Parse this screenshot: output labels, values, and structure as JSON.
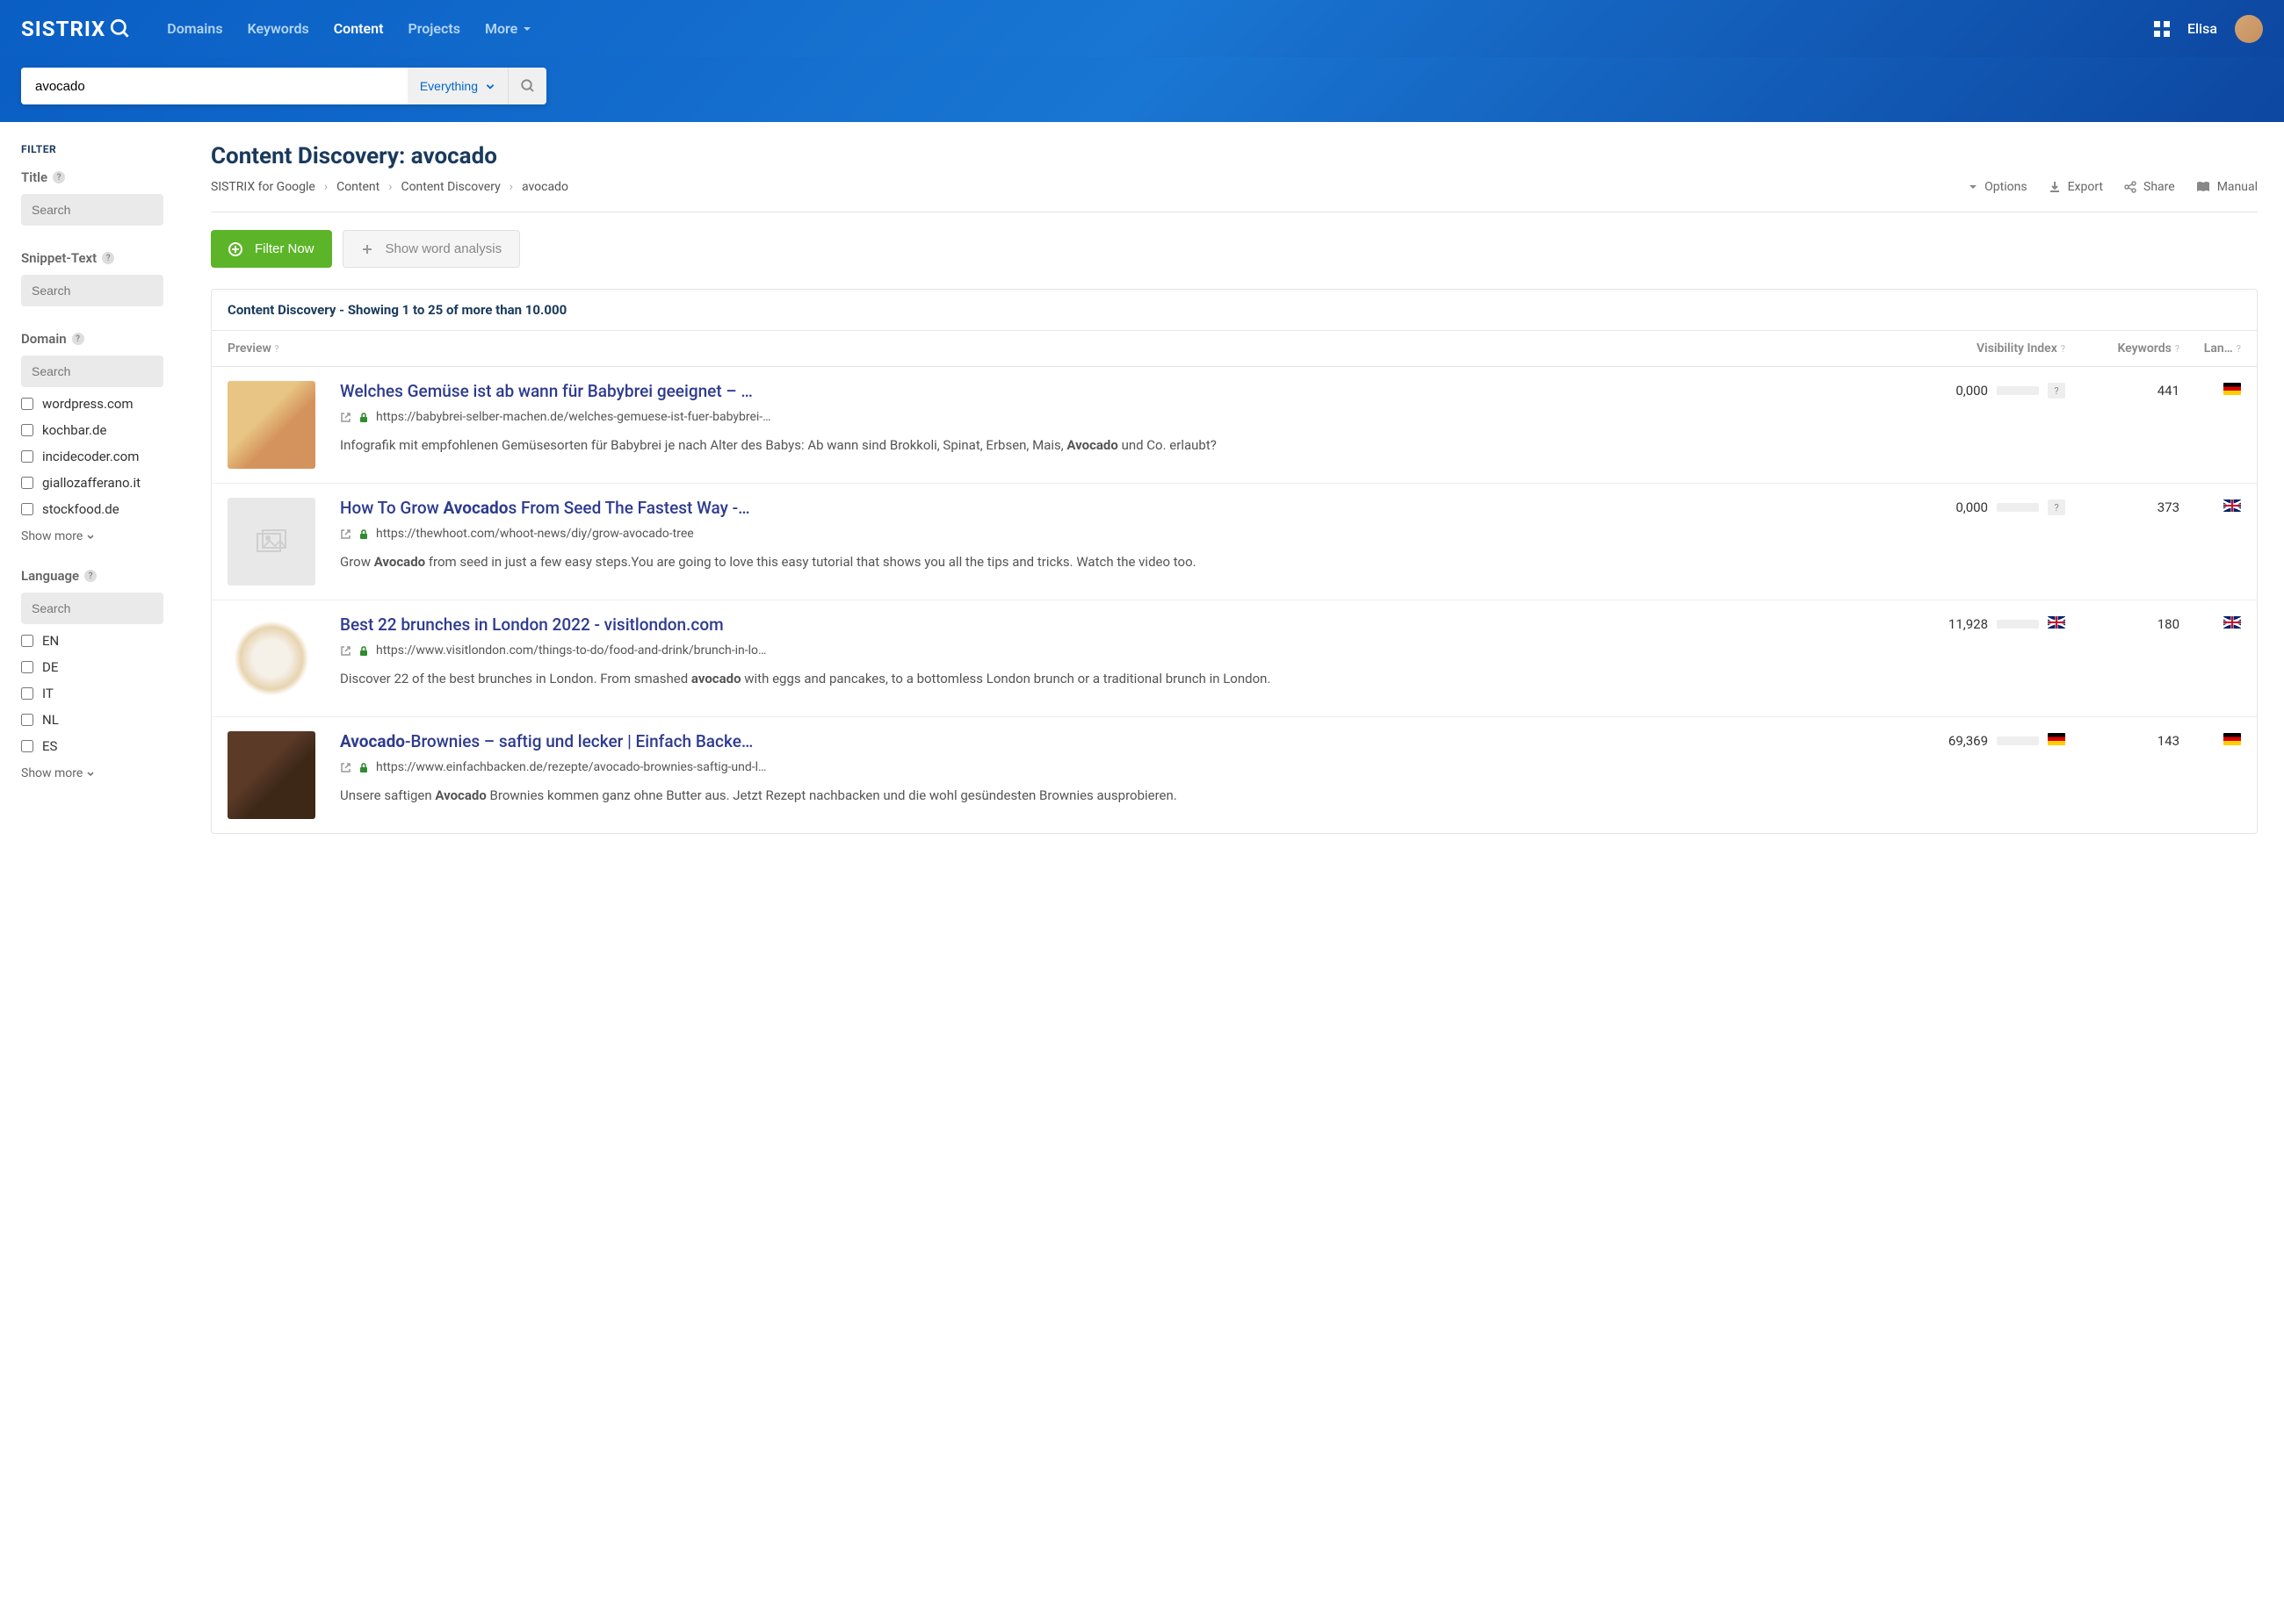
{
  "header": {
    "logo": "SISTRIX",
    "nav": {
      "domains": "Domains",
      "keywords": "Keywords",
      "content": "Content",
      "projects": "Projects",
      "more": "More"
    },
    "user": "Elisa"
  },
  "search": {
    "value": "avocado",
    "filter": "Everything"
  },
  "sidebar": {
    "heading": "FILTER",
    "title": {
      "label": "Title",
      "placeholder": "Search"
    },
    "snippet": {
      "label": "Snippet-Text",
      "placeholder": "Search"
    },
    "domain": {
      "label": "Domain",
      "placeholder": "Search",
      "options": [
        "wordpress.com",
        "kochbar.de",
        "incidecoder.com",
        "giallozafferano.it",
        "stockfood.de"
      ],
      "show_more": "Show more"
    },
    "language": {
      "label": "Language",
      "placeholder": "Search",
      "options": [
        "EN",
        "DE",
        "IT",
        "NL",
        "ES"
      ],
      "show_more": "Show more"
    }
  },
  "main": {
    "title": "Content Discovery: avocado",
    "breadcrumb": [
      "SISTRIX for Google",
      "Content",
      "Content Discovery",
      "avocado"
    ],
    "actions": {
      "options": "Options",
      "export": "Export",
      "share": "Share",
      "manual": "Manual"
    },
    "buttons": {
      "filter_now": "Filter Now",
      "word_analysis": "Show word analysis"
    },
    "results_header": "Content Discovery - Showing 1 to 25 of more than 10.000",
    "columns": {
      "preview": "Preview",
      "vi": "Visibility Index",
      "keywords": "Keywords",
      "lang": "Lan…"
    },
    "results": [
      {
        "title": "Welches Gemüse ist ab wann für Babybrei geeignet – …",
        "url": "https://babybrei-selber-machen.de/welches-gemuese-ist-fuer-babybrei-…",
        "snippet_pre": "Infografik mit empfohlenen Gemüsesorten für Babybrei je nach Alter des Babys: Ab wann sind Brokkoli, Spinat, Erbsen, Mais, ",
        "snippet_bold": "Avocado",
        "snippet_post": " und Co. erlaubt?",
        "vi": "0,000",
        "vi_fill": 0,
        "vi_flag": "?",
        "keywords": "441",
        "lang": "de",
        "thumb": "food1"
      },
      {
        "title_pre": "How To Grow ",
        "title_bold": "Avocado",
        "title_post": "s From Seed The Fastest Way -…",
        "url": "https://thewhoot.com/whoot-news/diy/grow-avocado-tree",
        "snippet_pre": "Grow ",
        "snippet_bold": "Avocado",
        "snippet_post": " from seed in just a few easy steps.You are going to love this easy tutorial that shows you all the tips and tricks. Watch the video too.",
        "vi": "0,000",
        "vi_fill": 0,
        "vi_flag": "?",
        "keywords": "373",
        "lang": "gb",
        "thumb": "placeholder"
      },
      {
        "title": "Best 22 brunches in London 2022 - visitlondon.com",
        "url": "https://www.visitlondon.com/things-to-do/food-and-drink/brunch-in-lo…",
        "snippet_pre": "Discover 22 of the best brunches in London. From smashed ",
        "snippet_bold": "avocado",
        "snippet_post": " with eggs and pancakes, to a bottomless London brunch or a traditional brunch in London.",
        "vi": "11,928",
        "vi_fill": 8,
        "vi_flag": "gb",
        "keywords": "180",
        "lang": "gb",
        "thumb": "food2"
      },
      {
        "title_bold": "Avocado",
        "title_post": "-Brownies – saftig und lecker | Einfach Backe…",
        "url": "https://www.einfachbacken.de/rezepte/avocado-brownies-saftig-und-l…",
        "snippet_pre": "Unsere saftigen ",
        "snippet_bold": "Avocado",
        "snippet_post": " Brownies kommen ganz ohne Butter aus. Jetzt Rezept nachbacken und die wohl gesündesten Brownies ausprobieren.",
        "vi": "69,369",
        "vi_fill": 45,
        "vi_flag": "de",
        "keywords": "143",
        "lang": "de",
        "thumb": "food3"
      }
    ]
  }
}
